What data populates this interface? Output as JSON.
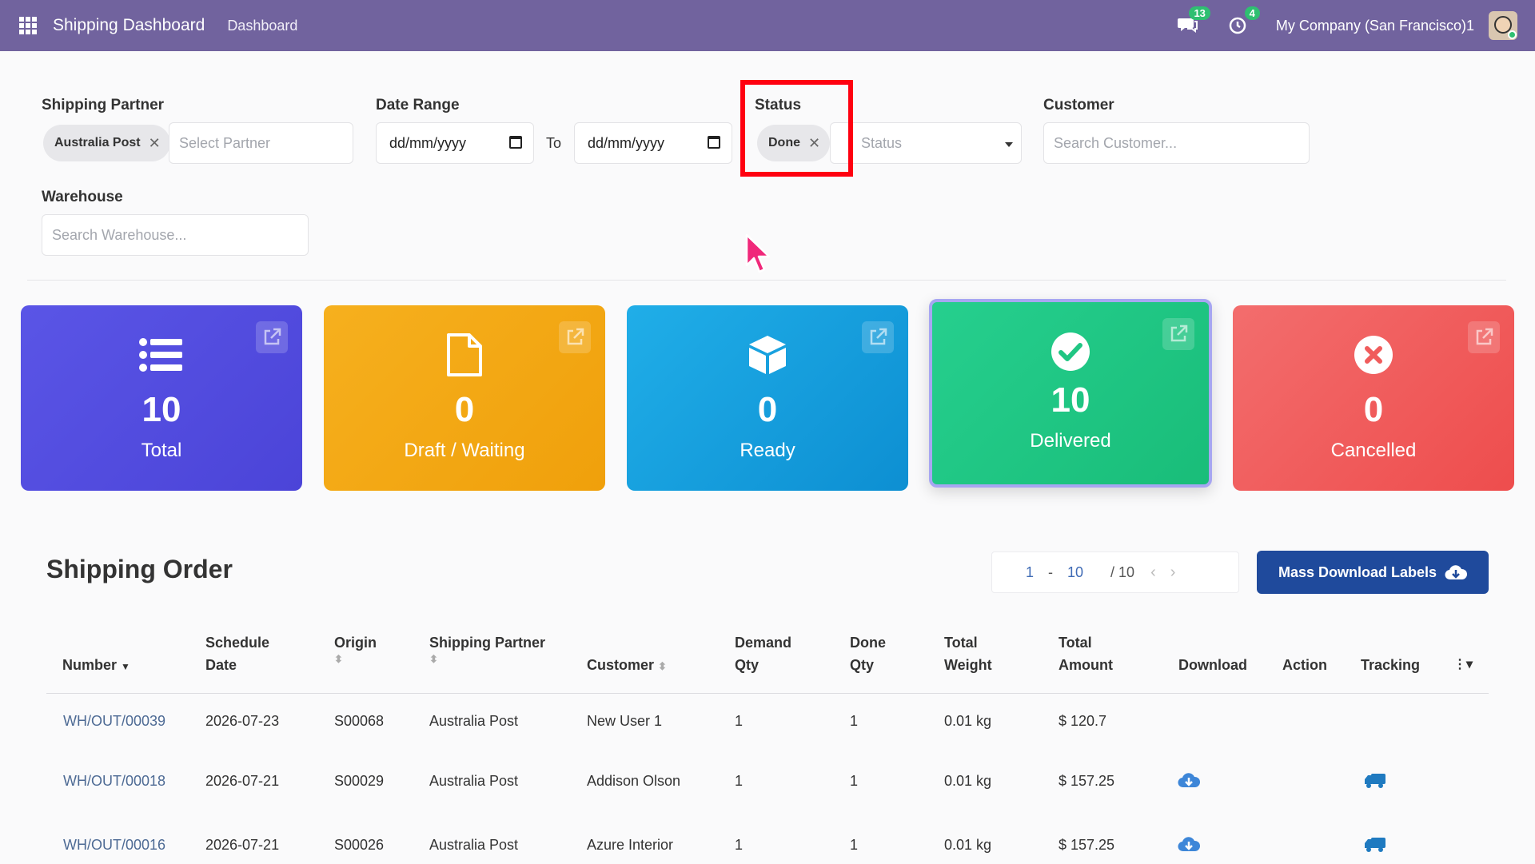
{
  "navbar": {
    "app_title": "Shipping Dashboard",
    "menu_item": "Dashboard",
    "messages_count": "13",
    "activities_count": "4",
    "company": "My Company (San Francisco)1",
    "icons": [
      "apps-grid-icon",
      "chat-icon",
      "clock-icon",
      "avatar"
    ],
    "color": "#71639e"
  },
  "filters": {
    "shipping_partner": {
      "label": "Shipping Partner",
      "chip": "Australia Post",
      "placeholder": "Select Partner"
    },
    "date_range": {
      "label": "Date Range",
      "from": "dd/mm/yyyy",
      "to_label": "To",
      "to": "dd/mm/yyyy"
    },
    "status": {
      "label": "Status",
      "chip": "Done",
      "placeholder": "Status"
    },
    "customer": {
      "label": "Customer",
      "placeholder": "Search Customer..."
    },
    "warehouse": {
      "label": "Warehouse",
      "placeholder": "Search Warehouse..."
    }
  },
  "cards": [
    {
      "value": "10",
      "label": "Total",
      "icon": "list-icon",
      "color": "#4f49dd"
    },
    {
      "value": "0",
      "label": "Draft / Waiting",
      "icon": "file-icon",
      "color": "#f3a713"
    },
    {
      "value": "0",
      "label": "Ready",
      "icon": "box-icon",
      "color": "#159ddc"
    },
    {
      "value": "10",
      "label": "Delivered",
      "icon": "check-circle-icon",
      "color": "#20c683"
    },
    {
      "value": "0",
      "label": "Cancelled",
      "icon": "x-circle-icon",
      "color": "#f05c5c"
    }
  ],
  "orders": {
    "title": "Shipping Order",
    "pager": {
      "start": "1",
      "dash": "-",
      "end": "10",
      "total": "/ 10"
    },
    "mass_download": "Mass Download Labels",
    "columns": {
      "number": "Number",
      "schedule_date": [
        "Schedule",
        "Date"
      ],
      "origin": "Origin",
      "partner": "Shipping Partner",
      "customer": "Customer",
      "demand_qty": [
        "Demand",
        "Qty"
      ],
      "done_qty": [
        "Done",
        "Qty"
      ],
      "total_weight": [
        "Total",
        "Weight"
      ],
      "total_amount": [
        "Total",
        "Amount"
      ],
      "download": "Download",
      "action": "Action",
      "tracking": "Tracking"
    },
    "rows": [
      {
        "number": "WH/OUT/00039",
        "date": "2026-07-23",
        "origin": "S00068",
        "partner": "Australia Post",
        "customer": "New User 1",
        "demand": "1",
        "done": "1",
        "weight": "0.01 kg",
        "amount": "$ 120.7"
      },
      {
        "number": "WH/OUT/00018",
        "date": "2026-07-21",
        "origin": "S00029",
        "partner": "Australia Post",
        "customer": "Addison Olson",
        "demand": "1",
        "done": "1",
        "weight": "0.01 kg",
        "amount": "$ 157.25"
      },
      {
        "number": "WH/OUT/00016",
        "date": "2026-07-21",
        "origin": "S00026",
        "partner": "Australia Post",
        "customer": "Azure Interior",
        "demand": "1",
        "done": "1",
        "weight": "0.01 kg",
        "amount": "$ 157.25"
      }
    ]
  }
}
